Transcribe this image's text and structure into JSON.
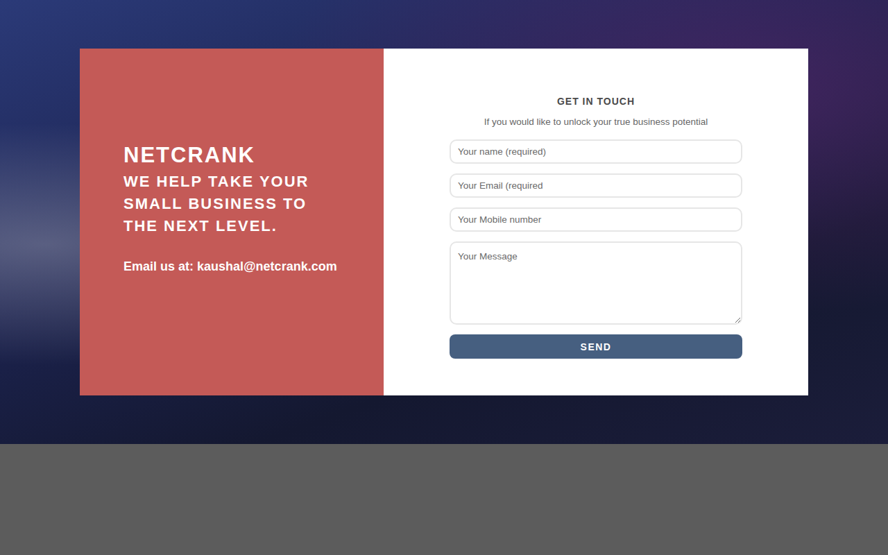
{
  "brand": {
    "name": "NETCRANK",
    "tagline": "WE HELP TAKE YOUR SMALL BUSINESS TO THE NEXT LEVEL.",
    "email": "Email us at: kaushal@netcrank.com"
  },
  "form": {
    "title": "GET IN TOUCH",
    "subtitle": "If you would like to unlock your true business potential",
    "fields": [
      {
        "kind": "input",
        "placeholder": "Your name (required)"
      },
      {
        "kind": "input",
        "placeholder": "Your Email (required"
      },
      {
        "kind": "input",
        "placeholder": "Your Mobile number"
      },
      {
        "kind": "textarea",
        "placeholder": "Your Message"
      }
    ],
    "button": "SEND"
  }
}
